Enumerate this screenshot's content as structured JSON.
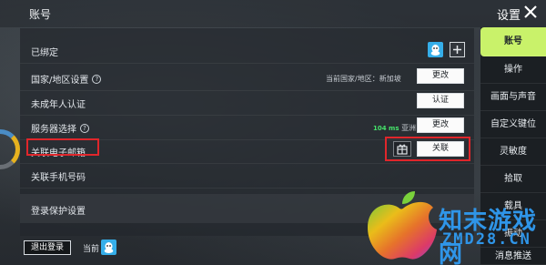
{
  "header": {
    "account_title": "账号",
    "settings_title": "设置"
  },
  "rows": [
    {
      "label": "已绑定"
    },
    {
      "label": "国家/地区设置",
      "meta": "当前国家/地区：新加坡",
      "button": "更改"
    },
    {
      "label": "未成年人认证",
      "button": "认证"
    },
    {
      "label": "服务器选择",
      "ping": "104 ms",
      "region": "亚洲",
      "button": "更改"
    },
    {
      "label": "关联电子邮箱",
      "button": "关联"
    },
    {
      "label": "关联手机号码"
    }
  ],
  "protect": {
    "label": "登录保护设置"
  },
  "footer": {
    "logout_label": "退出登录",
    "current_label": "当前"
  },
  "sidebar": {
    "items": [
      {
        "label": "账号",
        "active": true
      },
      {
        "label": "操作"
      },
      {
        "label": "画面与声音"
      },
      {
        "label": "自定义键位"
      },
      {
        "label": "灵敏度"
      },
      {
        "label": "拾取"
      },
      {
        "label": "载具"
      },
      {
        "label": "振动"
      },
      {
        "label": "消息推送"
      }
    ]
  },
  "watermark": {
    "text": "知末游戏网",
    "url": "ZMD28.CN"
  },
  "colors": {
    "accent": "#c9f26a",
    "highlight": "#e0262b",
    "ping": "#45e26a",
    "qq": "#35aee9"
  },
  "icons": [
    "close-icon",
    "qq-icon",
    "plus-icon",
    "help-icon",
    "gift-icon"
  ]
}
